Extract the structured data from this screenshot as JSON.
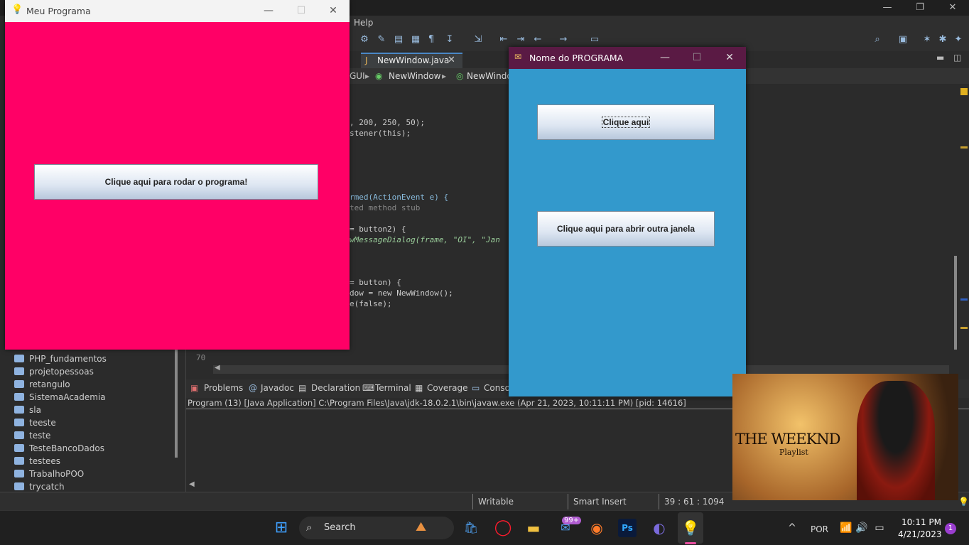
{
  "eclipse": {
    "menu_help": "Help",
    "editor_tab": "NewWindow.java",
    "breadcrumb": [
      "GUI",
      "NewWindow",
      "NewWindow"
    ],
    "code_lines": [
      {
        "text": ", 200, 250, 50);"
      },
      {
        "text": "stener(this);"
      },
      {
        "text": "rmed(ActionEvent e) {"
      },
      {
        "text": "ted method stub"
      },
      {
        "text": "= button2) {"
      },
      {
        "text": "wMessageDialog(frame, \"OI\", \"Jan"
      },
      {
        "text": "= button) {"
      },
      {
        "text": "dow = new NewWindow();"
      },
      {
        "text": "e(false);"
      }
    ],
    "line_number": "70",
    "bottom_tabs": [
      "Problems",
      "Javadoc",
      "Declaration",
      "Terminal",
      "Coverage",
      "Conso"
    ],
    "console_header": "Program (13) [Java Application] C:\\Program Files\\Java\\jdk-18.0.2.1\\bin\\javaw.exe  (Apr 21, 2023, 10:11:11 PM) [pid: 14616]",
    "projects": [
      "PHP_fundamentos",
      "projetopessoas",
      "retangulo",
      "SistemaAcademia",
      "sla",
      "teeste",
      "teste",
      "TesteBancoDados",
      "testees",
      "TrabalhoPOO",
      "trycatch"
    ],
    "status": {
      "writable": "Writable",
      "insert": "Smart Insert",
      "position": "39 : 61 : 1094"
    }
  },
  "window1": {
    "title": "Meu Programa",
    "bg_color": "#ff0066",
    "button_label": "Clique aqui para rodar o programa!"
  },
  "window2": {
    "title": "Nome do PROGRAMA",
    "bg_color": "#3399cc",
    "button1_label": "Clique aqui",
    "button2_label": "Clique aqui para abrir outra janela"
  },
  "media": {
    "title": "THE WEEKND",
    "subtitle": "Playlist"
  },
  "taskbar": {
    "search_placeholder": "Search",
    "mail_badge": "99+",
    "language": "POR",
    "time": "10:11 PM",
    "date": "4/21/2023",
    "notification_count": "1"
  }
}
